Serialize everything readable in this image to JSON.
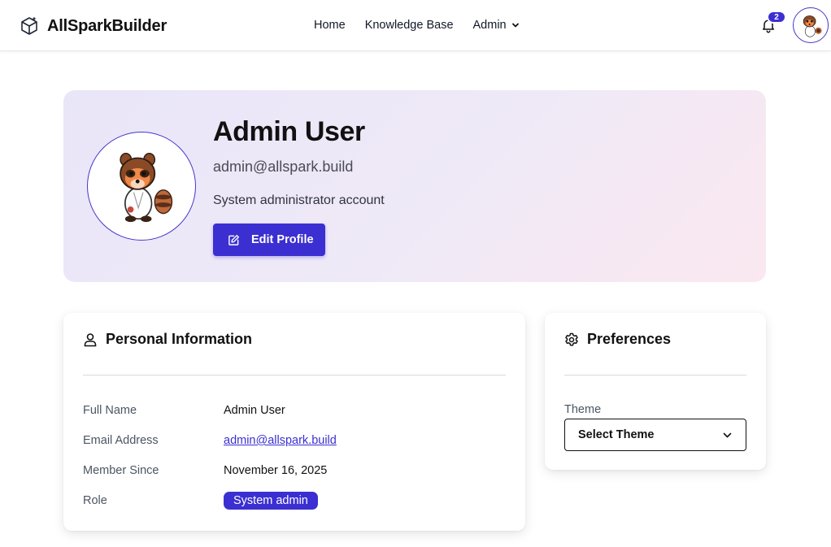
{
  "header": {
    "brand": "AllSparkBuilder",
    "nav": [
      {
        "label": "Home"
      },
      {
        "label": "Knowledge Base"
      },
      {
        "label": "Admin"
      }
    ],
    "notifications_count": "2",
    "icons": {
      "logo": "cube-icon",
      "bell": "bell-icon",
      "admin_dropdown": "chevron-down-icon"
    }
  },
  "profile": {
    "name": "Admin User",
    "email": "admin@allspark.build",
    "description": "System administrator account",
    "edit_button": "Edit Profile"
  },
  "personal_info": {
    "title": "Personal Information",
    "rows": [
      {
        "label": "Full Name",
        "value": "Admin User"
      },
      {
        "label": "Email Address",
        "value": "admin@allspark.build"
      },
      {
        "label": "Member Since",
        "value": "November 16, 2025"
      },
      {
        "label": "Role",
        "value": "System admin"
      }
    ]
  },
  "preferences": {
    "title": "Preferences",
    "theme_label": "Theme",
    "theme_value": "Select Theme"
  },
  "colors": {
    "accent": "#3b2fd2",
    "hero_gradient_start": "#e9e6f8",
    "hero_gradient_end": "#fbe8f0"
  }
}
